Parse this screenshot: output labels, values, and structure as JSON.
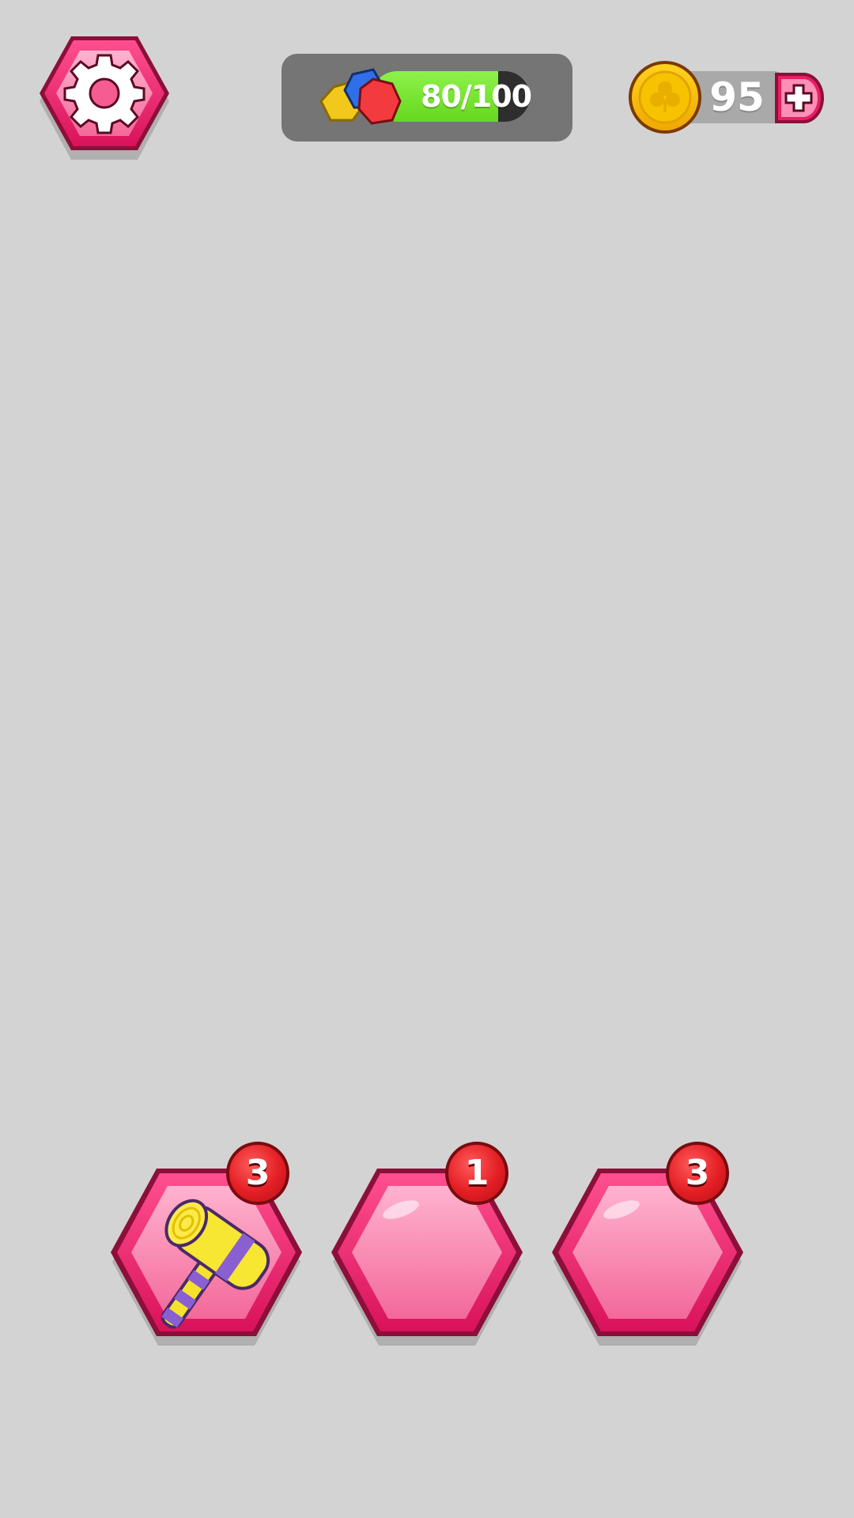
{
  "settings": {
    "icon": "gear-icon"
  },
  "progress": {
    "icon": "gems-icon",
    "text": "80/100",
    "value": 80,
    "max": 100,
    "fill_color": "#7ae23a"
  },
  "coins": {
    "icon": "clover-coin-icon",
    "value": "95",
    "add_icon": "plus-icon"
  },
  "tools": [
    {
      "name": "hammer",
      "count": "3",
      "icon": "hammer-icon"
    },
    {
      "name": "empty-slot",
      "count": "1",
      "icon": ""
    },
    {
      "name": "empty-slot",
      "count": "3",
      "icon": ""
    }
  ],
  "colors": {
    "background": "#d3d3d3",
    "accent_pink": "#e91e63",
    "badge_red": "#e31e24",
    "coin_gold": "#f6c400"
  }
}
